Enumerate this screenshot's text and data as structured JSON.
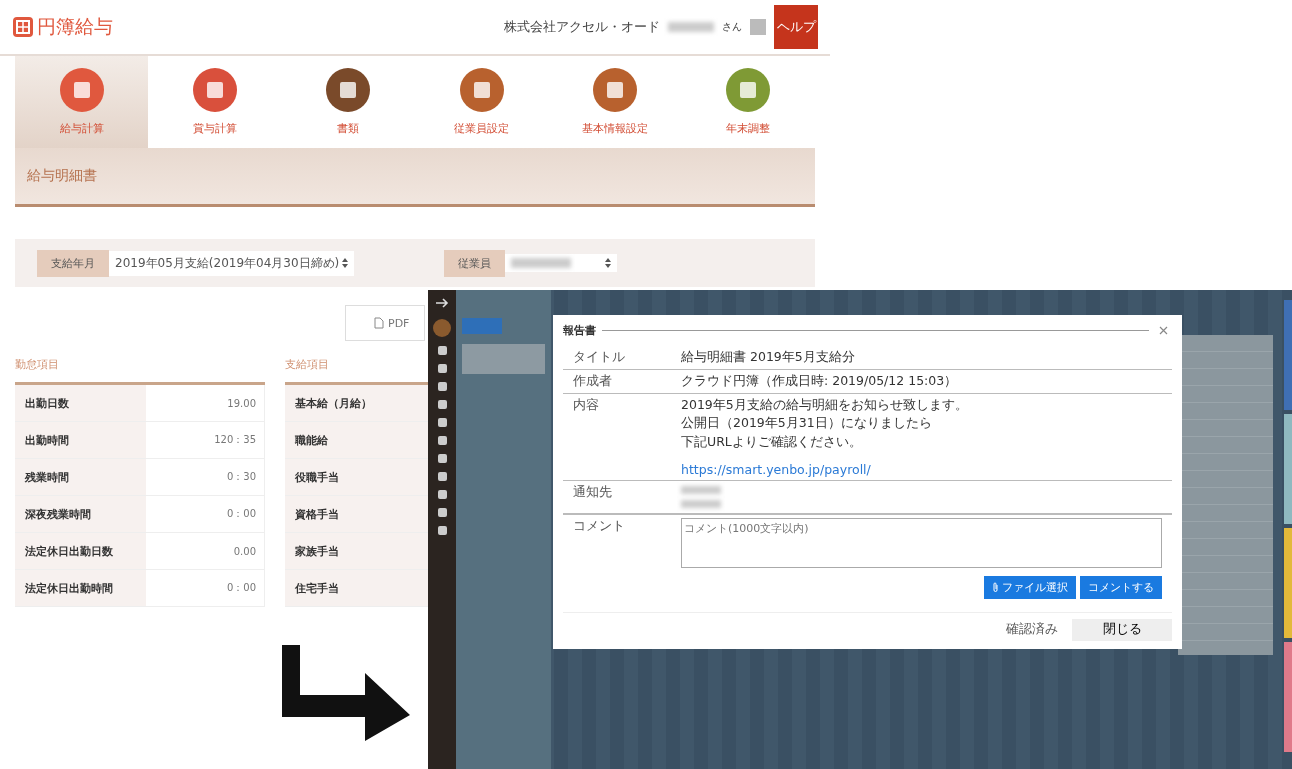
{
  "payroll_app": {
    "logo": "円簿給与",
    "company": "株式会社アクセル・オード",
    "user_suffix": "さん",
    "help": "ヘルプ",
    "nav": [
      {
        "label": "給与計算",
        "selected": true,
        "color": "#e0583e"
      },
      {
        "label": "賞与計算",
        "selected": false,
        "color": "#d9503c"
      },
      {
        "label": "書類",
        "selected": false,
        "color": "#7a4a2a"
      },
      {
        "label": "従業員設定",
        "selected": false,
        "color": "#b8612e"
      },
      {
        "label": "基本情報設定",
        "selected": false,
        "color": "#b8612e"
      },
      {
        "label": "年末調整",
        "selected": false,
        "color": "#7f9a35"
      }
    ],
    "page_title": "給与明細書",
    "filters": [
      {
        "label": "支給年月",
        "value": "2019年05月支給(2019年04月30日締め)"
      },
      {
        "label": "従業員"
      }
    ],
    "pdf_button": "PDF",
    "attendance": {
      "title": "勤怠項目",
      "rows": [
        {
          "label": "出勤日数",
          "value": "19.00"
        },
        {
          "label": "出勤時間",
          "value": "120：35"
        },
        {
          "label": "残業時間",
          "value": "0：30"
        },
        {
          "label": "深夜残業時間",
          "value": "0：00"
        },
        {
          "label": "法定休日出勤日数",
          "value": "0.00"
        },
        {
          "label": "法定休日出勤時間",
          "value": "0：00"
        }
      ]
    },
    "payments": {
      "title": "支給項目",
      "rows": [
        "基本給（月給）",
        "職能給",
        "役職手当",
        "資格手当",
        "家族手当",
        "住宅手当"
      ]
    }
  },
  "chat_app": {
    "side_tabs": [
      {
        "color": "#3f6fb5"
      },
      {
        "color": "#8fb9c0"
      },
      {
        "color": "#e3b93a"
      },
      {
        "color": "#e07a8a"
      }
    ],
    "dialog": {
      "title": "報告書",
      "rows": [
        {
          "label": "タイトル",
          "lines": [
            "給与明細書 2019年5月支給分"
          ]
        },
        {
          "label": "作成者",
          "lines": [
            "クラウド円簿（作成日時: 2019/05/12 15:03）"
          ]
        },
        {
          "label": "内容",
          "lines": [
            "2019年5月支給の給与明細をお知らせ致します。",
            "公開日（2019年5月31日）になりましたら",
            "下記URLよりご確認ください。"
          ],
          "link": "https://smart.yenbo.jp/payroll/"
        }
      ],
      "notify_label": "通知先",
      "comment_label": "コメント",
      "comment_placeholder": "コメント(1000文字以内)",
      "file_button": "ファイル選択",
      "comment_button": "コメントする",
      "confirmed": "確認済み",
      "close": "閉じる"
    }
  }
}
